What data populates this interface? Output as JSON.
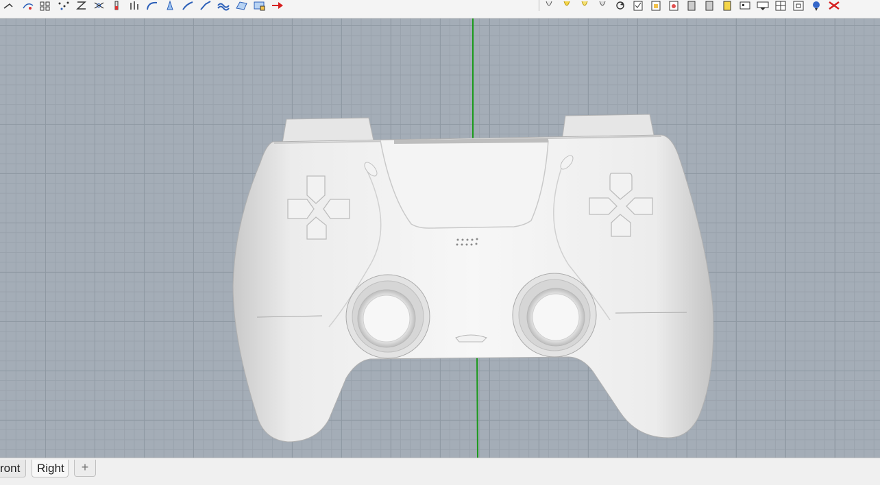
{
  "toolbar": {
    "left_icons": [
      "curve-icon",
      "point-edit-icon",
      "array-icon",
      "scatter-points-icon",
      "z-text-icon",
      "network-icon",
      "dimension-icon",
      "blend-icon",
      "arc-icon",
      "extrude-icon",
      "fillet-icon",
      "sweep-icon",
      "wave-icon",
      "surface-icon",
      "patch-icon",
      "red-arrow-icon"
    ],
    "right_icons": [
      "light-bulb-icon",
      "light-bulb-icon",
      "light-bulb-icon",
      "light-bulb-icon",
      "rotate-icon",
      "check-doc-icon",
      "yellow-doc-icon",
      "render-doc-icon",
      "layer-icon",
      "layer-icon",
      "yellow-layer-icon",
      "snap-icon",
      "view-icon",
      "grid-icon",
      "frame-icon",
      "blue-tool-icon",
      "red-tool-icon"
    ]
  },
  "viewport": {
    "grid_color": "#8f99a3",
    "background_color": "#a4adb7",
    "y_axis_color": "#1a9a1a",
    "model": "game-controller"
  },
  "tabs": {
    "front_label": "ront",
    "right_label": "Right",
    "add_label": "+"
  }
}
